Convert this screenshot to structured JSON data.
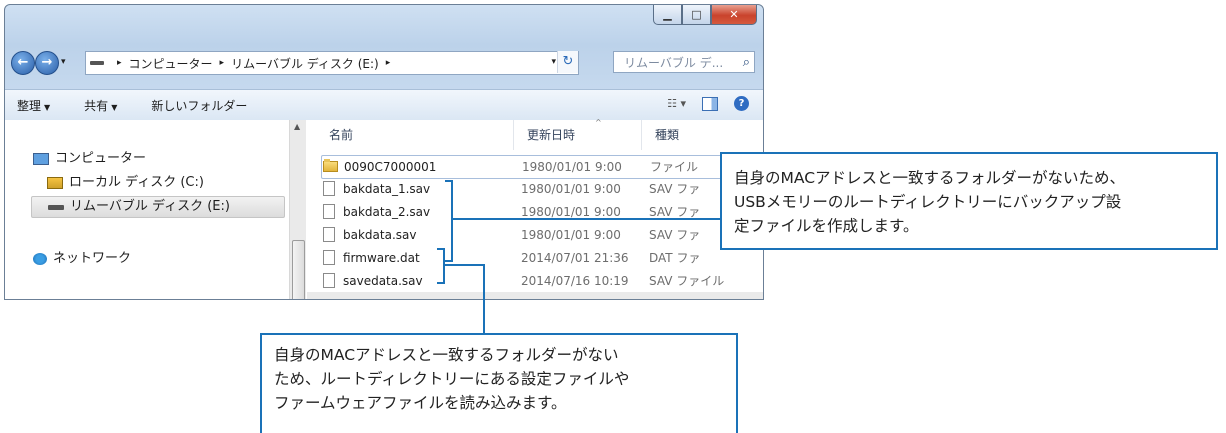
{
  "window": {
    "caption": {
      "minimize_icon": "minimize-icon",
      "maximize_icon": "maximize-icon",
      "close_icon": "close-icon"
    },
    "address": {
      "crumbs": [
        "コンピューター",
        "リムーバブル ディスク (E:)"
      ],
      "search_placeholder": "リムーバブル デ..."
    },
    "commands": [
      {
        "label": "整理",
        "has_dropdown": true
      },
      {
        "label": "共有",
        "has_dropdown": true
      },
      {
        "label": "新しいフォルダー",
        "has_dropdown": false
      }
    ],
    "nav": {
      "items": [
        {
          "label": "コンピューター",
          "icon": "computer-icon"
        },
        {
          "label": "ローカル ディスク (C:)",
          "icon": "local-disk-icon"
        },
        {
          "label": "リムーバブル ディスク (E:)",
          "icon": "removable-disk-icon",
          "selected": true
        },
        {
          "label": "ネットワーク",
          "icon": "network-icon"
        }
      ]
    },
    "list": {
      "columns": [
        "名前",
        "更新日時",
        "種類"
      ],
      "sorted_by": "更新日時",
      "rows": [
        {
          "name": "0090C7000001",
          "date": "1980/01/01 9:00",
          "type": "ファイル",
          "kind": "folder"
        },
        {
          "name": "bakdata_1.sav",
          "date": "1980/01/01 9:00",
          "type": "SAV ファ",
          "kind": "file"
        },
        {
          "name": "bakdata_2.sav",
          "date": "1980/01/01 9:00",
          "type": "SAV ファ",
          "kind": "file"
        },
        {
          "name": "bakdata.sav",
          "date": "1980/01/01 9:00",
          "type": "SAV ファ",
          "kind": "file"
        },
        {
          "name": "firmware.dat",
          "date": "2014/07/01 21:36",
          "type": "DAT ファ",
          "kind": "file"
        },
        {
          "name": "savedata.sav",
          "date": "2014/07/16 10:19",
          "type": "SAV ファイル",
          "kind": "file"
        }
      ]
    }
  },
  "callouts": {
    "backup": {
      "lines": [
        "自身のMACアドレスと一致するフォルダーがないため、",
        "USBメモリーのルートディレクトリーにバックアップ設",
        "定ファイルを作成します。"
      ]
    },
    "load": {
      "lines": [
        "自身のMACアドレスと一致するフォルダーがない",
        "ため、ルートディレクトリーにある設定ファイルや",
        "ファームウェアファイルを読み込みます。"
      ]
    }
  },
  "colors": {
    "accent": "#1a72b8",
    "window_frame": "#bcd2ea"
  }
}
